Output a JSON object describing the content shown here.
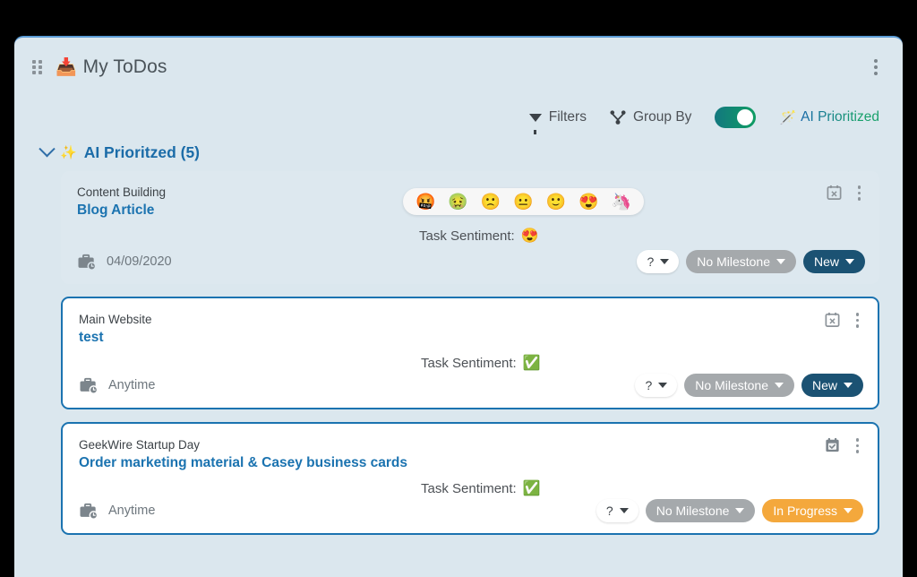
{
  "window": {
    "title": "My ToDos",
    "tray_icon": "inbox-tray-icon",
    "drag_handle_icon": "drag-handle-icon",
    "menu_icon": "kebab-menu-icon"
  },
  "toolbar": {
    "filters_label": "Filters",
    "filters_icon": "funnel-icon",
    "group_by_label": "Group By",
    "group_by_icon": "hierarchy-icon",
    "ai_toggle_on": true,
    "ai_label": "AI Prioritized",
    "ai_icon": "magic-wand-icon",
    "toggle_color": "#0f9d63"
  },
  "group": {
    "chevron_icon": "chevron-down-icon",
    "sparkle_icon": "✨",
    "title": "AI Prioritzed (5)",
    "title_color": "#1b6ca8"
  },
  "emoji_picker": {
    "options": [
      "🤬",
      "🤢",
      "🙁",
      "😐",
      "🙂",
      "😍",
      "🦄"
    ]
  },
  "sentiment_label": "Task Sentiment:",
  "tasks": [
    {
      "project": "Content Building",
      "title": "Blog Article",
      "due": "04/09/2020",
      "sentiment_emoji": "😍",
      "calendar_icon": "calendar-cancel-icon",
      "style": "plain",
      "show_picker": true,
      "pills": {
        "priority": "?",
        "milestone": "No Milestone",
        "status": "New",
        "status_color": "#1b5273"
      }
    },
    {
      "project": "Main Website",
      "title": "test",
      "due": "Anytime",
      "sentiment_emoji": "✅",
      "calendar_icon": "calendar-cancel-icon",
      "style": "outlined",
      "show_picker": false,
      "pills": {
        "priority": "?",
        "milestone": "No Milestone",
        "status": "New",
        "status_color": "#1b5273"
      }
    },
    {
      "project": "GeekWire Startup Day",
      "title": "Order marketing material & Casey business cards",
      "due": "Anytime",
      "sentiment_emoji": "✅",
      "calendar_icon": "calendar-check-icon",
      "style": "outlined",
      "show_picker": false,
      "pills": {
        "priority": "?",
        "milestone": "No Milestone",
        "status": "In Progress",
        "status_color": "#f4a83c"
      }
    }
  ]
}
